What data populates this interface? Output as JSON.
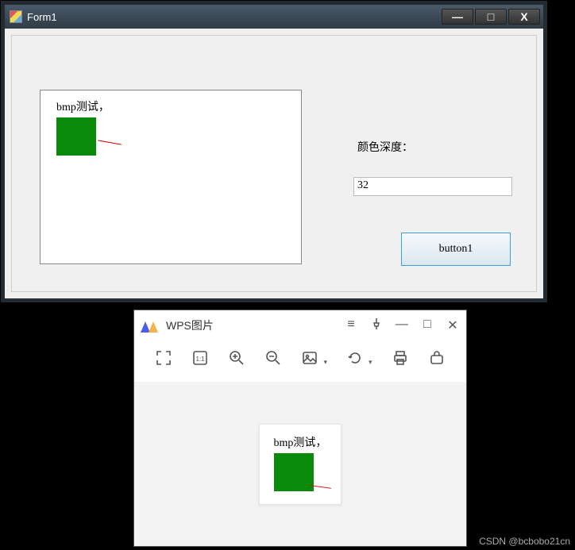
{
  "form": {
    "title": "Form1",
    "picturebox": {
      "text": "bmp测试，"
    },
    "label_depth": "颜色深度：",
    "textbox_value": "32",
    "button_label": "button1"
  },
  "wps": {
    "title": "WPS图片",
    "image_text": "bmp测试，",
    "toolbar": {
      "fullscreen": "fullscreen",
      "fit": "1:1",
      "zoom_in": "zoom-in",
      "zoom_out": "zoom-out",
      "image_tools": "image",
      "rotate": "rotate",
      "print": "print",
      "more": "toolbox"
    }
  },
  "watermark": "CSDN @bcbobo21cn"
}
